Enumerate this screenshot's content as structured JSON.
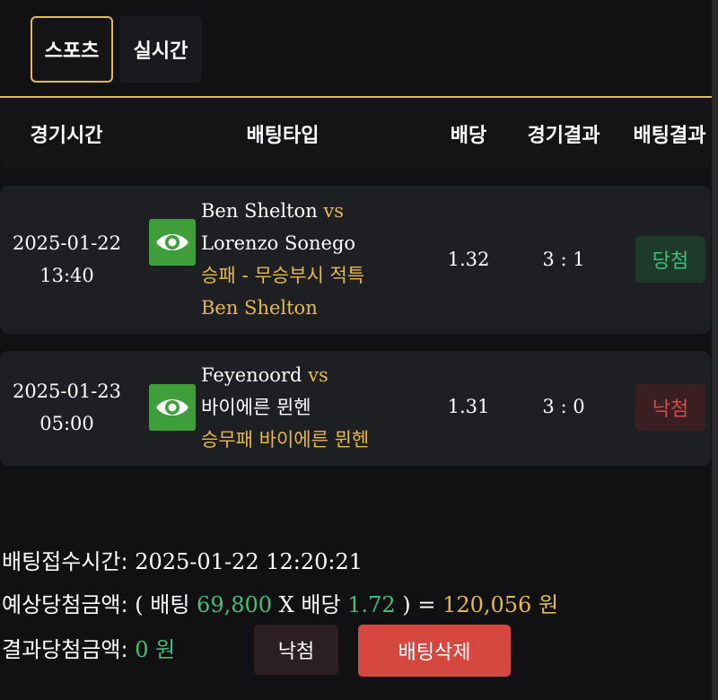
{
  "tabs": [
    {
      "label": "스포츠",
      "active": true
    },
    {
      "label": "실시간",
      "active": false
    }
  ],
  "table": {
    "headers": [
      "경기시간",
      "배팅타입",
      "배당",
      "경기결과",
      "배팅결과"
    ],
    "rows": [
      {
        "date": "2025-01-22",
        "time": "13:40",
        "home": "Ben Shelton",
        "vs": "vs",
        "away": "Lorenzo Sonego",
        "bet_type": "승패 - 무승부시 적특",
        "pick": "Ben Shelton",
        "odds": "1.32",
        "score": "3 : 1",
        "result": "당첨",
        "result_color": "#3fbf77"
      },
      {
        "date": "2025-01-23",
        "time": "05:00",
        "home": "Feyenoord",
        "vs": "vs",
        "away": "바이에른 뮌헨",
        "bet_type": "승무패",
        "pick": "바이에른 뮌헨",
        "odds": "1.31",
        "score": "3 : 0",
        "result": "낙첨",
        "result_color": "#d54a4a"
      }
    ]
  },
  "summary": {
    "receipt_label": "배팅접수시간:",
    "receipt_time": "2025-01-22 12:20:21",
    "expected_label": "예상당첨금액:",
    "paren_open": "(",
    "bet_word": "배팅",
    "bet_amount": "69,800",
    "times": "X",
    "odds_word": "배당",
    "total_odds": "1.72",
    "paren_close": ")",
    "equals": "=",
    "expected_amount": "120,056",
    "expected_unit": "원",
    "result_label": "결과당첨금액:",
    "result_amount": "0",
    "result_unit": "원"
  },
  "actions": {
    "status_label": "낙첨",
    "delete_label": "배팅삭제"
  },
  "colors": {
    "accent_gold": "#e7b84a",
    "win_green": "#3fbf77",
    "lose_red": "#d54a4a",
    "delete_button": "#d4483f",
    "eye_button": "#3e9f3a"
  },
  "icons": [
    "eye-icon"
  ]
}
